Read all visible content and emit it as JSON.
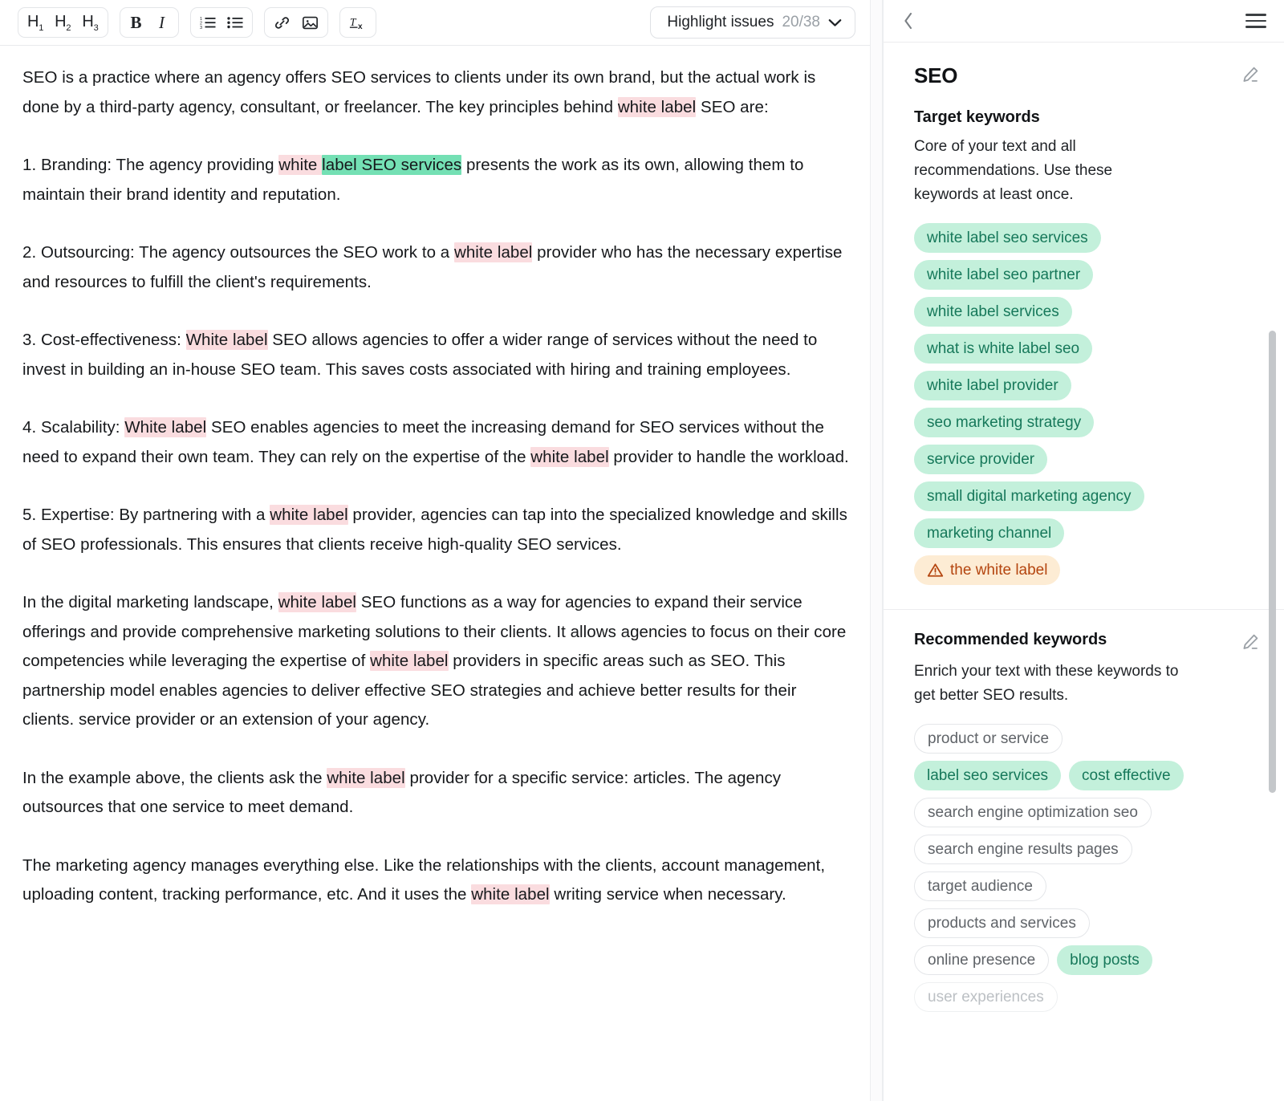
{
  "toolbar": {
    "heading_buttons": [
      {
        "name": "h1",
        "label": "H",
        "sub": "1"
      },
      {
        "name": "h2",
        "label": "H",
        "sub": "2"
      },
      {
        "name": "h3",
        "label": "H",
        "sub": "3"
      }
    ],
    "bold_label": "B",
    "italic_label": "I",
    "ordered_list_icon": "ordered-list-icon",
    "bullet_list_icon": "bullet-list-icon",
    "link_icon": "link-icon",
    "image_icon": "image-icon",
    "clear_format_label": "Tx",
    "highlight": {
      "label": "Highlight issues",
      "count": "20/38",
      "caret_icon": "chevron-down-icon"
    }
  },
  "document": {
    "paragraphs": [
      {
        "id": "p1",
        "runs": [
          {
            "t": "SEO is a practice where an agency offers SEO services to clients under its own brand, but the actual work is done by a third-party agency, consultant, or freelancer. The key principles behind ",
            "h": "none"
          },
          {
            "t": "white label",
            "h": "pink"
          },
          {
            "t": " SEO are:",
            "h": "none"
          }
        ]
      },
      {
        "id": "p2",
        "runs": [
          {
            "t": "1. Branding: The agency providing ",
            "h": "none"
          },
          {
            "t": "white ",
            "h": "pink"
          },
          {
            "t": "label SEO services",
            "h": "green"
          },
          {
            "t": " presents the work as its own, allowing them to maintain their brand identity and reputation.",
            "h": "none"
          }
        ]
      },
      {
        "id": "p3",
        "runs": [
          {
            "t": "2. Outsourcing: The agency outsources the SEO work to a ",
            "h": "none"
          },
          {
            "t": "white label",
            "h": "pink"
          },
          {
            "t": " provider who has the necessary expertise and resources to fulfill the client's requirements.",
            "h": "none"
          }
        ]
      },
      {
        "id": "p4",
        "runs": [
          {
            "t": "3. Cost-effectiveness: ",
            "h": "none"
          },
          {
            "t": "White label",
            "h": "pink"
          },
          {
            "t": " SEO allows agencies to offer a wider range of services without the need to invest in building an in-house SEO team. This saves costs associated with hiring and training employees.",
            "h": "none"
          }
        ]
      },
      {
        "id": "p5",
        "runs": [
          {
            "t": "4. Scalability: ",
            "h": "none"
          },
          {
            "t": "White label",
            "h": "pink"
          },
          {
            "t": " SEO enables agencies to meet the increasing demand for SEO services without the need to expand their own team. They can rely on the expertise of the ",
            "h": "none"
          },
          {
            "t": "white label",
            "h": "pink"
          },
          {
            "t": " provider to handle the workload.",
            "h": "none"
          }
        ]
      },
      {
        "id": "p6",
        "runs": [
          {
            "t": "5. Expertise: By partnering with a ",
            "h": "none"
          },
          {
            "t": "white label",
            "h": "pink"
          },
          {
            "t": " provider, agencies can tap into the specialized knowledge and skills of SEO professionals. This ensures that clients receive high-quality SEO services.",
            "h": "none"
          }
        ]
      },
      {
        "id": "p7",
        "runs": [
          {
            "t": "In the digital marketing landscape, ",
            "h": "none"
          },
          {
            "t": "white label",
            "h": "pink"
          },
          {
            "t": " SEO functions as a way for agencies to expand their service offerings and provide comprehensive marketing solutions to their clients. It allows agencies to focus on their core competencies while leveraging the expertise of ",
            "h": "none"
          },
          {
            "t": "white label",
            "h": "pink"
          },
          {
            "t": " providers in specific areas such as SEO. This partnership model enables agencies to deliver effective SEO strategies and achieve better results for their clients. service provider or an extension of your agency.",
            "h": "none"
          }
        ]
      },
      {
        "id": "p8",
        "runs": [
          {
            "t": "In the example above, the clients ask the ",
            "h": "none"
          },
          {
            "t": "white label",
            "h": "pink"
          },
          {
            "t": " provider for a specific service: articles. The agency outsources that one service to meet demand.",
            "h": "none"
          }
        ]
      },
      {
        "id": "p9",
        "runs": [
          {
            "t": "The marketing agency manages everything else. Like the relationships with the clients, account management, uploading content, tracking performance, etc. And it uses the ",
            "h": "none"
          },
          {
            "t": "white label",
            "h": "pink"
          },
          {
            "t": " writing service when necessary.",
            "h": "none"
          }
        ]
      }
    ]
  },
  "sidebar": {
    "header": {
      "back_icon": "chevron-left-icon",
      "menu_icon": "hamburger-menu-icon"
    },
    "title": "SEO",
    "target": {
      "heading": "Target keywords",
      "description": "Core of your text and all recommendations. Use these keywords at least once.",
      "edit_icon": "pencil-icon",
      "chips": [
        {
          "label": "white label seo services",
          "style": "green"
        },
        {
          "label": "white label seo partner",
          "style": "green"
        },
        {
          "label": "white label services",
          "style": "green"
        },
        {
          "label": "what is white label seo",
          "style": "green"
        },
        {
          "label": "white label provider",
          "style": "green"
        },
        {
          "label": "seo marketing strategy",
          "style": "green"
        },
        {
          "label": "service provider",
          "style": "green"
        },
        {
          "label": "small digital marketing agency",
          "style": "green"
        },
        {
          "label": "marketing channel",
          "style": "green"
        },
        {
          "label": "the white label",
          "style": "warn",
          "icon": "warning-triangle-icon"
        }
      ]
    },
    "recommended": {
      "heading": "Recommended keywords",
      "description": "Enrich your text with these keywords to get better SEO results.",
      "edit_icon": "pencil-icon",
      "chips": [
        {
          "label": "product or service",
          "style": "plain"
        },
        {
          "label": "label seo services",
          "style": "green"
        },
        {
          "label": "cost effective",
          "style": "green"
        },
        {
          "label": "search engine optimization seo",
          "style": "plain"
        },
        {
          "label": "search engine results pages",
          "style": "plain"
        },
        {
          "label": "target audience",
          "style": "plain"
        },
        {
          "label": "products and services",
          "style": "plain"
        },
        {
          "label": "online presence",
          "style": "plain"
        },
        {
          "label": "blog posts",
          "style": "green"
        },
        {
          "label": "user experiences",
          "style": "plain-faded"
        }
      ]
    },
    "scrollbar": {
      "top_pct": 30,
      "height_pct": 42
    }
  },
  "colors": {
    "highlight_pink": "#fadcdf",
    "highlight_green": "#74e0b4",
    "chip_green_bg": "#c3f0db",
    "chip_green_text": "#16785a",
    "chip_warn_bg": "#fdecd4",
    "chip_warn_text": "#b4450f"
  }
}
